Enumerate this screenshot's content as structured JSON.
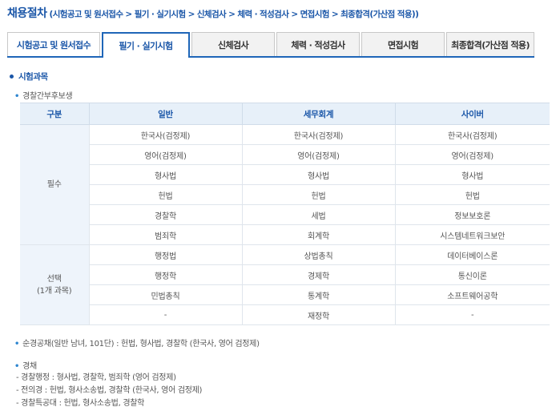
{
  "header": {
    "title": "채용절차",
    "subtitle": "(시험공고 및 원서접수 > 필기 · 실기시험 > 신체검사 > 체력 · 적성검사 > 면접시험 > 최종합격(가산점 적용))"
  },
  "tabs": [
    {
      "label": "시험공고 및 원서접수"
    },
    {
      "label": "필기 · 실기시험"
    },
    {
      "label": "신체검사"
    },
    {
      "label": "체력 · 적성검사"
    },
    {
      "label": "면접시험"
    },
    {
      "label": "최종합격(가산점 적용)"
    }
  ],
  "section": {
    "title": "시험과목"
  },
  "bullets": {
    "candidates": "경찰간부후보생",
    "open_hire": "순경공채(일반 남녀, 101단) : 헌법, 형사법, 경찰학 (한국사, 영어 검정제)",
    "experienced": "경채"
  },
  "table": {
    "headers": [
      "구분",
      "일반",
      "세무회계",
      "사이버"
    ],
    "required_label": "필수",
    "elective_label": "선택",
    "elective_sub": "(1개 과목)",
    "required_rows": [
      [
        "한국사(검정제)",
        "한국사(검정제)",
        "한국사(검정제)"
      ],
      [
        "영어(검정제)",
        "영어(검정제)",
        "영어(검정제)"
      ],
      [
        "형사법",
        "형사법",
        "형사법"
      ],
      [
        "헌법",
        "헌법",
        "헌법"
      ],
      [
        "경찰학",
        "세법",
        "정보보호론"
      ],
      [
        "범죄학",
        "회계학",
        "시스템네트워크보안"
      ]
    ],
    "elective_rows": [
      [
        "행정법",
        "상법총칙",
        "데이터베이스론"
      ],
      [
        "행정학",
        "경제학",
        "통신이론"
      ],
      [
        "민법총칙",
        "통계학",
        "소프트웨어공학"
      ],
      [
        "-",
        "재정학",
        "-"
      ]
    ]
  },
  "experienced_lines": [
    "- 경찰행정 : 형사법, 경찰학, 범죄학 (영어 검정제)",
    "- 전의경 : 헌법, 형사소송법, 경찰학 (한국사, 영어 검정제)",
    "- 경찰특공대 : 헌법, 형사소송법, 경찰학"
  ]
}
